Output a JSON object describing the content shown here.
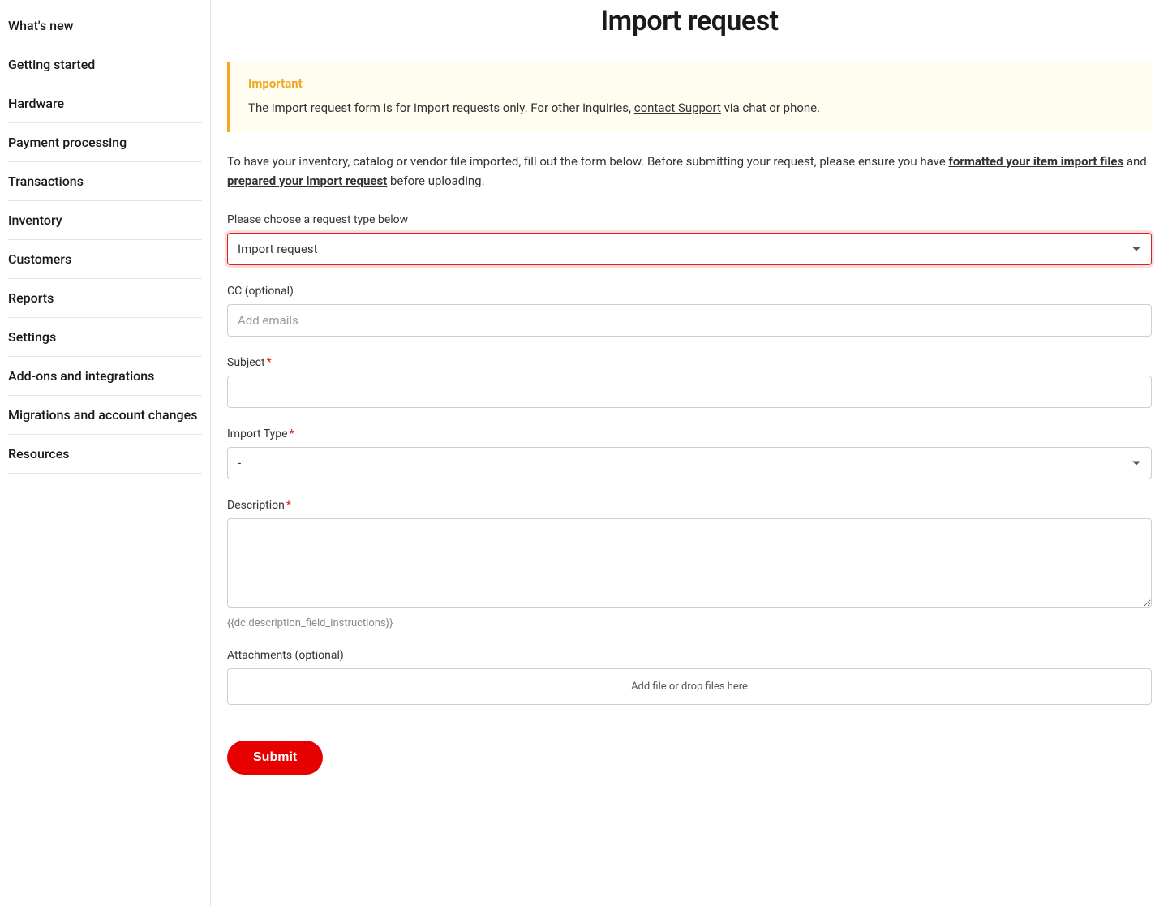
{
  "sidebar": {
    "items": [
      {
        "label": "What's new"
      },
      {
        "label": "Getting started"
      },
      {
        "label": "Hardware"
      },
      {
        "label": "Payment processing"
      },
      {
        "label": "Transactions"
      },
      {
        "label": "Inventory"
      },
      {
        "label": "Customers"
      },
      {
        "label": "Reports"
      },
      {
        "label": "Settings"
      },
      {
        "label": "Add-ons and integrations"
      },
      {
        "label": "Migrations and account changes"
      },
      {
        "label": "Resources"
      }
    ]
  },
  "page": {
    "title": "Import request"
  },
  "callout": {
    "title": "Important",
    "body_prefix": "The import request form is for import requests only. For other inquiries, ",
    "link_text": "contact Support",
    "body_suffix": " via chat or phone."
  },
  "intro": {
    "part1": "To have your inventory, catalog or vendor file imported, fill out the form below. Before submitting your request, please ensure you have ",
    "link1": "formatted your item import files",
    "part2": " and ",
    "link2": "prepared your import request",
    "part3": " before uploading."
  },
  "form": {
    "request_type": {
      "label": "Please choose a request type below",
      "selected": "Import request"
    },
    "cc": {
      "label": "CC (optional)",
      "placeholder": "Add emails",
      "value": ""
    },
    "subject": {
      "label": "Subject",
      "value": ""
    },
    "import_type": {
      "label": "Import Type",
      "selected": "-"
    },
    "description": {
      "label": "Description",
      "value": "",
      "hint": "{{dc.description_field_instructions}}"
    },
    "attachments": {
      "label": "Attachments (optional)",
      "dropzone_text": "Add file or drop files here"
    },
    "submit_label": "Submit"
  }
}
